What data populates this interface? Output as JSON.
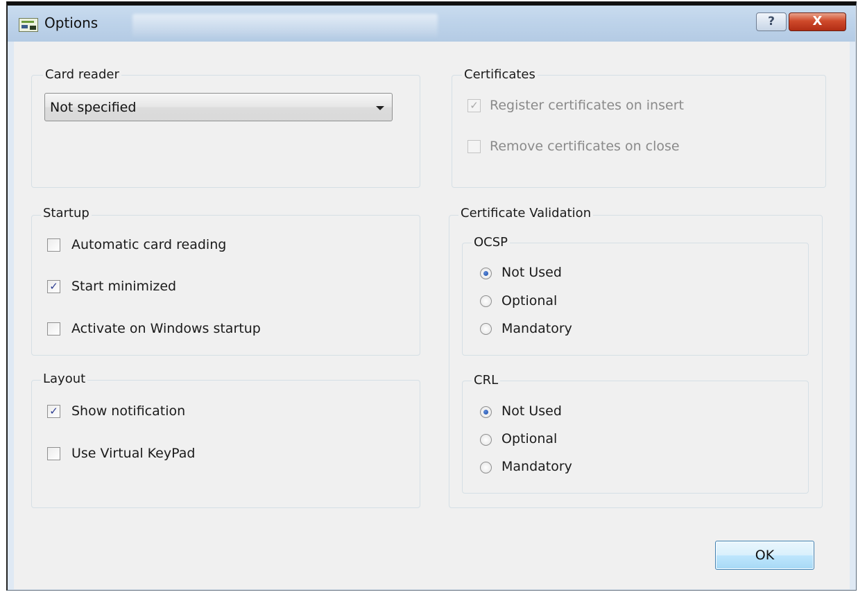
{
  "window": {
    "title": "Options",
    "help_label": "?",
    "close_label": "X"
  },
  "card_reader": {
    "title": "Card reader",
    "selected": "Not specified"
  },
  "certificates": {
    "title": "Certificates",
    "register": {
      "label": "Register certificates on insert",
      "checked": true,
      "enabled": false
    },
    "remove": {
      "label": "Remove certificates on close",
      "checked": false,
      "enabled": false
    }
  },
  "startup": {
    "title": "Startup",
    "items": [
      {
        "label": "Automatic card reading",
        "checked": false
      },
      {
        "label": "Start minimized",
        "checked": true
      },
      {
        "label": "Activate on Windows startup",
        "checked": false
      }
    ]
  },
  "layout": {
    "title": "Layout",
    "items": [
      {
        "label": "Show notification",
        "checked": true
      },
      {
        "label": "Use Virtual KeyPad",
        "checked": false
      }
    ]
  },
  "validation": {
    "title": "Certificate Validation",
    "ocsp": {
      "title": "OCSP",
      "options": [
        "Not Used",
        "Optional",
        "Mandatory"
      ],
      "selected": "Not Used"
    },
    "crl": {
      "title": "CRL",
      "options": [
        "Not Used",
        "Optional",
        "Mandatory"
      ],
      "selected": "Not Used"
    }
  },
  "buttons": {
    "ok": "OK"
  },
  "check_glyph": "✓",
  "icons": {
    "app": "options-window-icon",
    "help": "help-icon",
    "close": "close-icon",
    "dropdown": "chevron-down-icon"
  },
  "colors": {
    "accent": "#1e4fa8",
    "close_button": "#c7422a",
    "titlebar": "#bed3ea",
    "client_bg": "#f0f0f0"
  }
}
